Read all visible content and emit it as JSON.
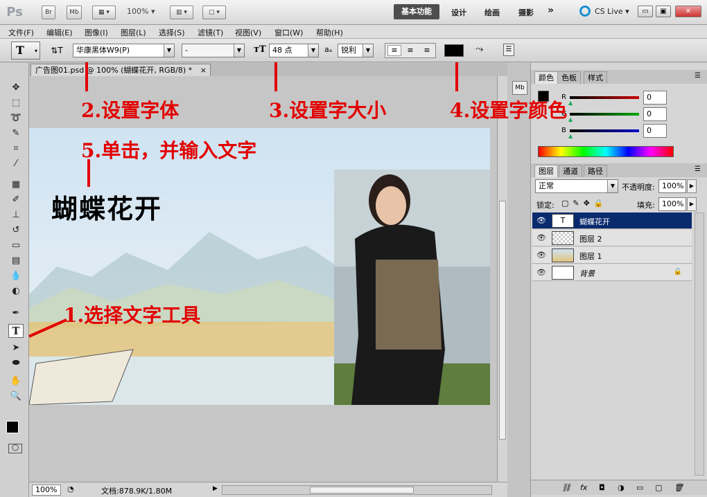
{
  "app": {
    "logo": "Ps",
    "br_label": "Br",
    "mb_label": "Mb",
    "zoom": "100%"
  },
  "workspace": {
    "active": "基本功能",
    "items": [
      "设计",
      "绘画",
      "摄影"
    ],
    "more": "»",
    "cslive": "CS Live"
  },
  "window_controls": {
    "minimize": "▭",
    "restore": "▣",
    "close": "✕"
  },
  "menubar": [
    "文件(F)",
    "编辑(E)",
    "图像(I)",
    "图层(L)",
    "选择(S)",
    "滤镜(T)",
    "视图(V)",
    "窗口(W)",
    "帮助(H)"
  ],
  "options": {
    "tool_label": "T",
    "font_family": "华康黑体W9(P)",
    "font_style": "-",
    "font_size": "48 点",
    "aa_label": "aₐ",
    "antialias": "锐利",
    "color": "#000000"
  },
  "document": {
    "tab": "广告图01.psd @ 100% (蝴蝶花开, RGB/8) *",
    "close": "×",
    "canvas_text": "蝴蝶花开"
  },
  "annotations": {
    "step1": "1.选择文字工具",
    "step2": "2.设置字体",
    "step3": "3.设置字大小",
    "step4": "4.设置字颜色",
    "step5": "5.单击，并输入文字"
  },
  "status": {
    "zoom": "100%",
    "doc": "文档:878.9K/1.80M"
  },
  "color_panel": {
    "tabs": [
      "颜色",
      "色板",
      "样式"
    ],
    "channels": [
      {
        "label": "R",
        "value": "0",
        "color": "#cc0000"
      },
      {
        "label": "G",
        "value": "0",
        "color": "#00aa00"
      },
      {
        "label": "B",
        "value": "0",
        "color": "#0000cc"
      }
    ]
  },
  "layers_panel": {
    "tabs": [
      "图层",
      "通道",
      "路径"
    ],
    "blend_mode": "正常",
    "opacity_label": "不透明度:",
    "opacity": "100%",
    "lock_label": "锁定:",
    "fill_label": "填充:",
    "fill": "100%",
    "layers": [
      {
        "name": "蝴蝶花开",
        "thumb": "T",
        "selected": true
      },
      {
        "name": "图层 2",
        "thumb": "",
        "selected": false
      },
      {
        "name": "图层 1",
        "thumb": "",
        "selected": false
      },
      {
        "name": "背景",
        "thumb": "",
        "selected": false
      }
    ],
    "bottom_icons": [
      "link-icon",
      "fx-icon",
      "mask-icon",
      "adjustment-icon",
      "group-icon",
      "new-layer-icon",
      "trash-icon"
    ]
  }
}
